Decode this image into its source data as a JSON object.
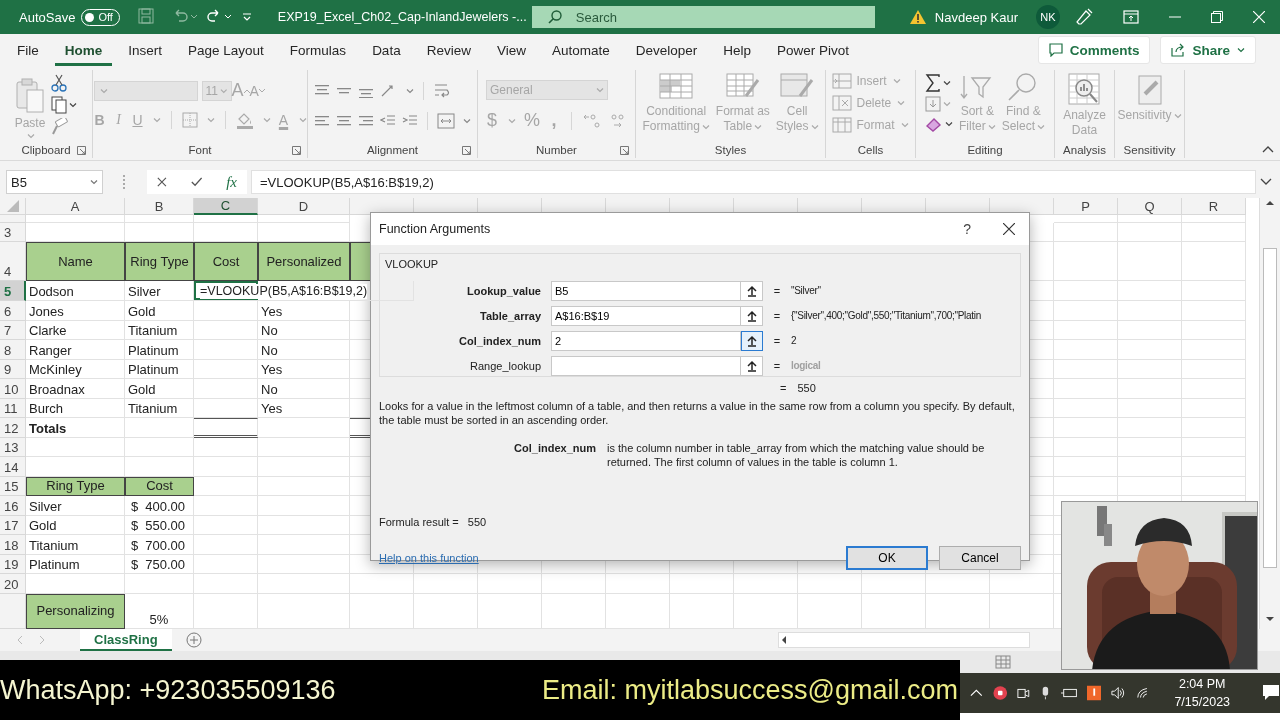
{
  "title_bar": {
    "autosave_label": "AutoSave",
    "autosave": {
      "on": false,
      "label": "Off"
    },
    "document_title": "EXP19_Excel_Ch02_Cap-InlandJewelers  -...",
    "search_placeholder": "Search",
    "user_name": "Navdeep Kaur",
    "user_initials": "NK"
  },
  "ribbon_tabs": [
    {
      "label": "File",
      "selected": false
    },
    {
      "label": "Home",
      "selected": true
    },
    {
      "label": "Insert",
      "selected": false
    },
    {
      "label": "Page Layout",
      "selected": false
    },
    {
      "label": "Formulas",
      "selected": false
    },
    {
      "label": "Data",
      "selected": false
    },
    {
      "label": "Review",
      "selected": false
    },
    {
      "label": "View",
      "selected": false
    },
    {
      "label": "Automate",
      "selected": false
    },
    {
      "label": "Developer",
      "selected": false
    },
    {
      "label": "Help",
      "selected": false
    },
    {
      "label": "Power Pivot",
      "selected": false
    }
  ],
  "comments_button": "Comments",
  "share_button": "Share",
  "ribbon_groups": [
    {
      "kind": "clipboard",
      "label": "Clipboard",
      "paste": {
        "label": "Paste",
        "disabled": true
      }
    },
    {
      "kind": "font",
      "label": "Font",
      "font_size": {
        "value": "11",
        "disabled": true
      },
      "grow": "A",
      "shrink": "A",
      "bold": "B",
      "italic": "I",
      "underline": "U",
      "font_color": "A"
    },
    {
      "kind": "alignment",
      "label": "Alignment"
    },
    {
      "kind": "number",
      "label": "Number",
      "format": {
        "value": "General",
        "disabled": true
      },
      "currency": "$",
      "percent": "%",
      "comma": ","
    },
    {
      "kind": "styles",
      "label": "Styles",
      "items": [
        {
          "lines": [
            "Conditional",
            "Formatting"
          ],
          "disabled": true
        },
        {
          "lines": [
            "Format as",
            "Table"
          ],
          "disabled": true
        },
        {
          "lines": [
            "Cell",
            "Styles"
          ],
          "disabled": true
        }
      ]
    },
    {
      "kind": "cells",
      "label": "Cells",
      "items": [
        {
          "label": "Insert",
          "disabled": true
        },
        {
          "label": "Delete",
          "disabled": true
        },
        {
          "label": "Format",
          "disabled": true
        }
      ]
    },
    {
      "kind": "editing",
      "label": "Editing",
      "items": [
        {
          "lines": [
            "Sort &",
            "Filter"
          ],
          "disabled": true
        },
        {
          "lines": [
            "Find &",
            "Select"
          ],
          "disabled": true
        }
      ]
    },
    {
      "kind": "analysis",
      "label": "Analysis",
      "items": [
        {
          "lines": [
            "Analyze",
            "Data"
          ],
          "disabled": true
        }
      ]
    },
    {
      "kind": "sensitivity",
      "label": "Sensitivity",
      "items": [
        {
          "lines": [
            "Sensitivity"
          ],
          "disabled": true
        }
      ]
    }
  ],
  "formula_bar": {
    "name_box": "B5",
    "function_label": "fx",
    "formula": "=VLOOKUP(B5,A$16:B$19,2)"
  },
  "sheet": {
    "columns": [
      {
        "label": "A",
        "selected": false
      },
      {
        "label": "B",
        "selected": false
      },
      {
        "label": "C",
        "selected": true
      },
      {
        "label": "D",
        "selected": false
      },
      {},
      {},
      {},
      {},
      {},
      {},
      {},
      {},
      {},
      {},
      {},
      {
        "label": "P",
        "selected": false
      },
      {
        "label": "Q",
        "selected": false
      },
      {
        "label": "R",
        "selected": false
      }
    ],
    "rows": [
      {
        "number": "3",
        "selected": false
      },
      {
        "number": "4",
        "selected": false,
        "cells": {
          "A": {
            "kind": "heading",
            "text": "Name"
          },
          "B": {
            "kind": "heading",
            "text": "Ring Type"
          },
          "C": {
            "kind": "heading",
            "text": "Cost"
          },
          "D": {
            "kind": "heading",
            "text": "Personalized"
          },
          "E": {
            "kind": "heading"
          }
        }
      },
      {
        "number": "5",
        "selected": true,
        "cells": {
          "A": {
            "kind": "text",
            "text": "Dodson"
          },
          "B": {
            "kind": "text",
            "text": "Silver"
          },
          "C": {
            "kind": "editing",
            "text": "=VLOOKUP(B5,A$16:B$19,2)"
          }
        }
      },
      {
        "number": "6",
        "selected": false,
        "cells": {
          "A": {
            "kind": "text",
            "text": "Jones"
          },
          "B": {
            "kind": "text",
            "text": "Gold"
          },
          "D": {
            "kind": "text",
            "text": "Yes"
          }
        }
      },
      {
        "number": "7",
        "selected": false,
        "cells": {
          "A": {
            "kind": "text",
            "text": "Clarke"
          },
          "B": {
            "kind": "text",
            "text": "Titanium"
          },
          "D": {
            "kind": "text",
            "text": "No"
          }
        }
      },
      {
        "number": "8",
        "selected": false,
        "cells": {
          "A": {
            "kind": "text",
            "text": "Ranger"
          },
          "B": {
            "kind": "text",
            "text": "Platinum"
          },
          "D": {
            "kind": "text",
            "text": "No"
          }
        }
      },
      {
        "number": "9",
        "selected": false,
        "cells": {
          "A": {
            "kind": "text",
            "text": "McKinley"
          },
          "B": {
            "kind": "text",
            "text": "Platinum"
          },
          "D": {
            "kind": "text",
            "text": "Yes"
          }
        }
      },
      {
        "number": "10",
        "selected": false,
        "cells": {
          "A": {
            "kind": "text",
            "text": "Broadnax"
          },
          "B": {
            "kind": "text",
            "text": "Gold"
          },
          "D": {
            "kind": "text",
            "text": "No"
          }
        }
      },
      {
        "number": "11",
        "selected": false,
        "cells": {
          "A": {
            "kind": "text",
            "text": "Burch"
          },
          "B": {
            "kind": "text",
            "text": "Titanium"
          },
          "D": {
            "kind": "text",
            "text": "Yes"
          }
        }
      },
      {
        "number": "12",
        "selected": false,
        "cells": {
          "A": {
            "kind": "bold",
            "text": "Totals"
          },
          "C": {
            "kind": "total"
          },
          "E": {
            "kind": "total"
          }
        }
      },
      {
        "number": "13",
        "selected": false
      },
      {
        "number": "14",
        "selected": false
      },
      {
        "number": "15",
        "selected": false,
        "cells": {
          "A": {
            "kind": "heading",
            "text": "Ring Type"
          },
          "B": {
            "kind": "heading",
            "text": "Cost"
          }
        }
      },
      {
        "number": "16",
        "selected": false,
        "cells": {
          "A": {
            "kind": "text",
            "text": "Silver"
          },
          "B": {
            "kind": "money",
            "currency": "$",
            "text": "400.00"
          }
        }
      },
      {
        "number": "17",
        "selected": false,
        "cells": {
          "A": {
            "kind": "text",
            "text": "Gold"
          },
          "B": {
            "kind": "money",
            "currency": "$",
            "text": "550.00"
          }
        }
      },
      {
        "number": "18",
        "selected": false,
        "cells": {
          "A": {
            "kind": "text",
            "text": "Titanium"
          },
          "B": {
            "kind": "money",
            "currency": "$",
            "text": "700.00"
          }
        }
      },
      {
        "number": "19",
        "selected": false,
        "cells": {
          "A": {
            "kind": "text",
            "text": "Platinum"
          },
          "B": {
            "kind": "money",
            "currency": "$",
            "text": "750.00"
          }
        }
      },
      {
        "number": "20",
        "selected": false
      },
      {
        "selected": false,
        "cells": {
          "A": {
            "kind": "heading",
            "text": "Personalizing"
          },
          "B": {
            "kind": "percent",
            "text": "5%"
          }
        }
      }
    ]
  },
  "dialog": {
    "title": "Function Arguments",
    "help_mark": "?",
    "function_name": "VLOOKUP",
    "arguments": [
      {
        "name": "Lookup_value",
        "required": true,
        "value": "B5",
        "focused": false,
        "equals": "=",
        "result": "\"Silver\"",
        "muted": false
      },
      {
        "name": "Table_array",
        "required": true,
        "value": "A$16:B$19",
        "focused": false,
        "equals": "=",
        "result": "{\"Silver\",400;\"Gold\",550;\"Titanium\",700;\"Platin",
        "muted": false
      },
      {
        "name": "Col_index_num",
        "required": true,
        "value": "2",
        "focused": true,
        "equals": "=",
        "result": "2",
        "muted": false
      },
      {
        "name": "Range_lookup",
        "required": false,
        "focused": false,
        "equals": "=",
        "result": "logical",
        "muted": true
      }
    ],
    "result_equals": "=",
    "result": "550",
    "description": "Looks for a value in the leftmost column of a table, and then returns a value in the same row from a column you specify. By default, the table must be sorted in an ascending order.",
    "argument_help": {
      "name": "Col_index_num",
      "text": "is the column number in table_array from which the matching value should be returned. The first column of values in the table is column 1."
    },
    "formula_result_label": "Formula result =",
    "formula_result": "550",
    "help_link": "Help on this function",
    "buttons": [
      {
        "label": "OK",
        "default": true
      },
      {
        "label": "Cancel",
        "default": false
      }
    ]
  },
  "sheet_tabs": [
    {
      "label": "ClassRing",
      "selected": true
    }
  ],
  "banner": {
    "whatsapp": "WhatsApp: +923035509136",
    "email": "Email: myitlabsuccess@gmail.com"
  },
  "taskbar": {
    "time": "2:04 PM",
    "date": "7/15/2023"
  }
}
